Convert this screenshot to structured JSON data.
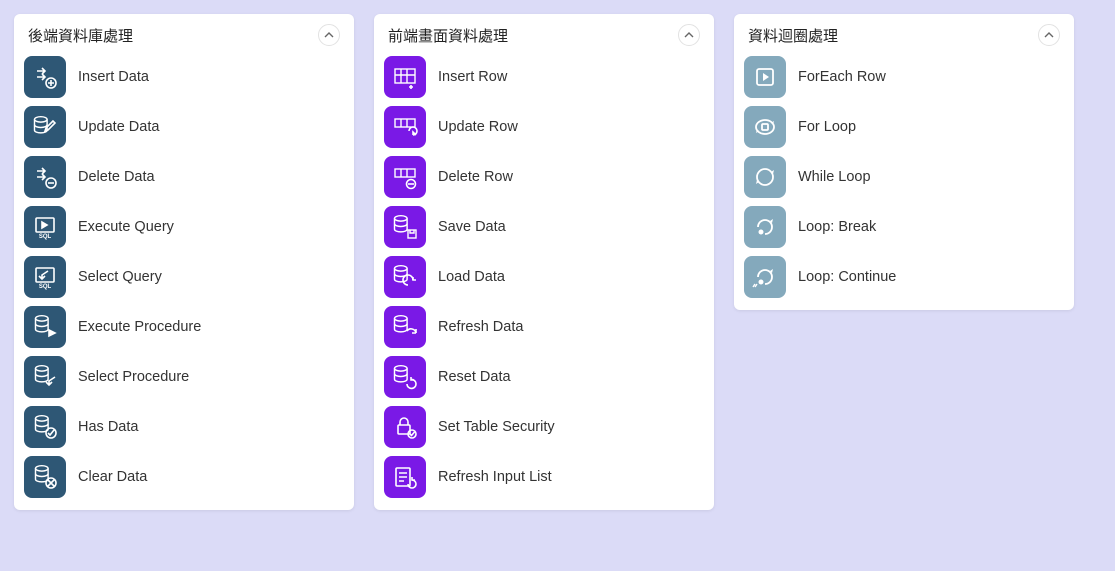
{
  "panels": [
    {
      "title": "後端資料庫處理",
      "color": "#2e5775",
      "items": [
        {
          "label": "Insert Data",
          "icon": "insert-data-icon"
        },
        {
          "label": "Update Data",
          "icon": "update-data-icon"
        },
        {
          "label": "Delete Data",
          "icon": "delete-data-icon"
        },
        {
          "label": "Execute Query",
          "icon": "execute-query-icon"
        },
        {
          "label": "Select Query",
          "icon": "select-query-icon"
        },
        {
          "label": "Execute Procedure",
          "icon": "execute-procedure-icon"
        },
        {
          "label": "Select Procedure",
          "icon": "select-procedure-icon"
        },
        {
          "label": "Has Data",
          "icon": "has-data-icon"
        },
        {
          "label": "Clear Data",
          "icon": "clear-data-icon"
        }
      ]
    },
    {
      "title": "前端畫面資料處理",
      "color": "#7a19e6",
      "items": [
        {
          "label": "Insert Row",
          "icon": "insert-row-icon"
        },
        {
          "label": "Update Row",
          "icon": "update-row-icon"
        },
        {
          "label": "Delete Row",
          "icon": "delete-row-icon"
        },
        {
          "label": "Save Data",
          "icon": "save-data-icon"
        },
        {
          "label": "Load Data",
          "icon": "load-data-icon"
        },
        {
          "label": "Refresh Data",
          "icon": "refresh-data-icon"
        },
        {
          "label": "Reset Data",
          "icon": "reset-data-icon"
        },
        {
          "label": "Set Table Security",
          "icon": "set-table-security-icon"
        },
        {
          "label": "Refresh Input List",
          "icon": "refresh-input-list-icon"
        }
      ]
    },
    {
      "title": "資料迴圈處理",
      "color": "#84a9bc",
      "items": [
        {
          "label": "ForEach Row",
          "icon": "foreach-row-icon"
        },
        {
          "label": "For Loop",
          "icon": "for-loop-icon"
        },
        {
          "label": "While Loop",
          "icon": "while-loop-icon"
        },
        {
          "label": "Loop: Break",
          "icon": "loop-break-icon"
        },
        {
          "label": "Loop: Continue",
          "icon": "loop-continue-icon"
        }
      ]
    }
  ]
}
